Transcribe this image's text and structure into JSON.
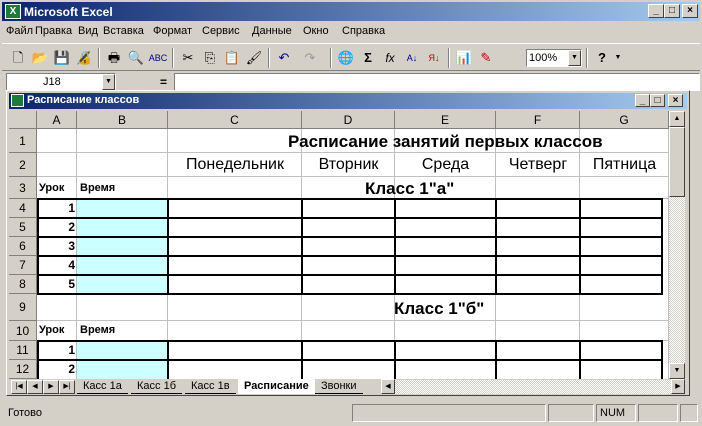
{
  "app": {
    "title": "Microsoft Excel",
    "icon": "excel-icon"
  },
  "caption_buttons": [
    "_",
    "□",
    "×"
  ],
  "menu": [
    "Файл",
    "Правка",
    "Вид",
    "Вставка",
    "Формат",
    "Сервис",
    "Данные",
    "Окно",
    "Справка"
  ],
  "toolbar": {
    "zoom": "100%"
  },
  "formula_bar": {
    "name_box": "J18",
    "equals": "="
  },
  "workbook": {
    "title": "Расписание классов"
  },
  "grid": {
    "columns": [
      "A",
      "B",
      "C",
      "D",
      "E",
      "F",
      "G"
    ],
    "rows": [
      "1",
      "2",
      "3",
      "4",
      "5",
      "6",
      "7",
      "8",
      "9",
      "10",
      "11",
      "12"
    ],
    "main_title": "Расписание занятий первых классов",
    "days": [
      "Понедельник",
      "Вторник",
      "Среда",
      "Четверг",
      "Пятница"
    ],
    "class_a": "Класс 1\"а\"",
    "class_b": "Класс 1\"б\"",
    "lesson_label": "Урок",
    "time_label": "Время",
    "lessons_a": [
      "1",
      "2",
      "3",
      "4",
      "5"
    ],
    "lessons_b": [
      "1",
      "2"
    ]
  },
  "sheet_tabs": [
    "Касс 1а",
    "Касс 1б",
    "Касс 1в",
    "Расписание",
    "Звонки"
  ],
  "active_tab": "Расписание",
  "status": {
    "ready": "Готово",
    "num": "NUM"
  }
}
